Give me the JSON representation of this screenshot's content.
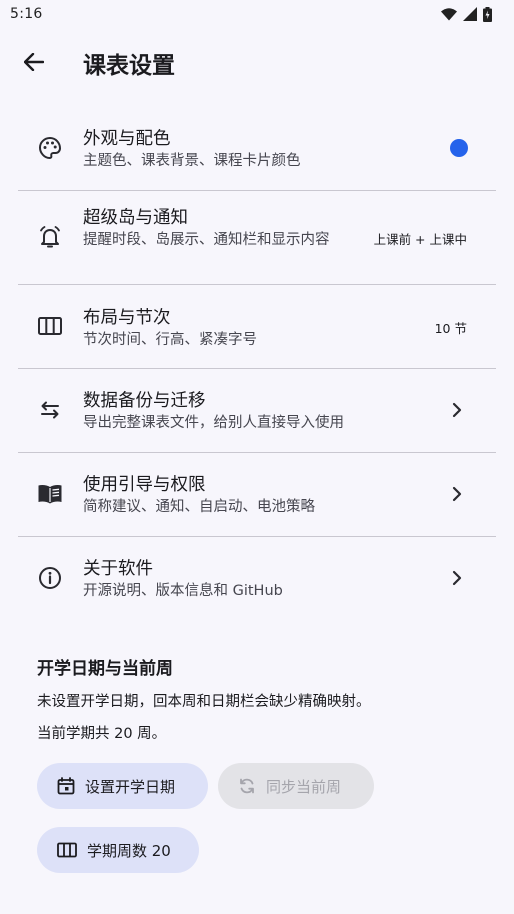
{
  "status": {
    "time": "5:16",
    "icons": [
      "wifi-icon",
      "cell-signal-icon",
      "battery-charging-icon"
    ]
  },
  "header": {
    "back_icon": "arrow-left-icon",
    "title": "课表设置"
  },
  "settings": [
    {
      "icon": "palette-icon",
      "title": "外观与配色",
      "subtitle": "主题色、课表背景、课程卡片颜色",
      "trailing_type": "color-dot",
      "trailing_color": "#2563eb"
    },
    {
      "icon": "bell-icon",
      "title": "超级岛与通知",
      "subtitle": "提醒时段、岛展示、通知栏和显示内容",
      "trailing_type": "text",
      "trailing": "上课前 + 上课中"
    },
    {
      "icon": "columns-icon",
      "title": "布局与节次",
      "subtitle": "节次时间、行高、紧凑字号",
      "trailing_type": "text",
      "trailing": "10 节"
    },
    {
      "icon": "swap-arrows-icon",
      "title": "数据备份与迁移",
      "subtitle": "导出完整课表文件，给别人直接导入使用",
      "trailing_type": "chevron"
    },
    {
      "icon": "book-icon",
      "title": "使用引导与权限",
      "subtitle": "简称建议、通知、自启动、电池策略",
      "trailing_type": "chevron"
    },
    {
      "icon": "info-icon",
      "title": "关于软件",
      "subtitle": "开源说明、版本信息和 GitHub",
      "trailing_type": "chevron"
    }
  ],
  "semester": {
    "title": "开学日期与当前周",
    "description": "未设置开学日期，回本周和日期栏会缺少精确映射。",
    "weeks_text": "当前学期共 20 周。",
    "set_date_label": "设置开学日期",
    "sync_week_label": "同步当前周",
    "weeks_button_label": "学期周数 20"
  },
  "colors": {
    "accent": "#2563eb",
    "chip_bg": "#dde1f8",
    "chip_disabled_bg": "#e3e3e7",
    "background": "#f7f6fc"
  }
}
